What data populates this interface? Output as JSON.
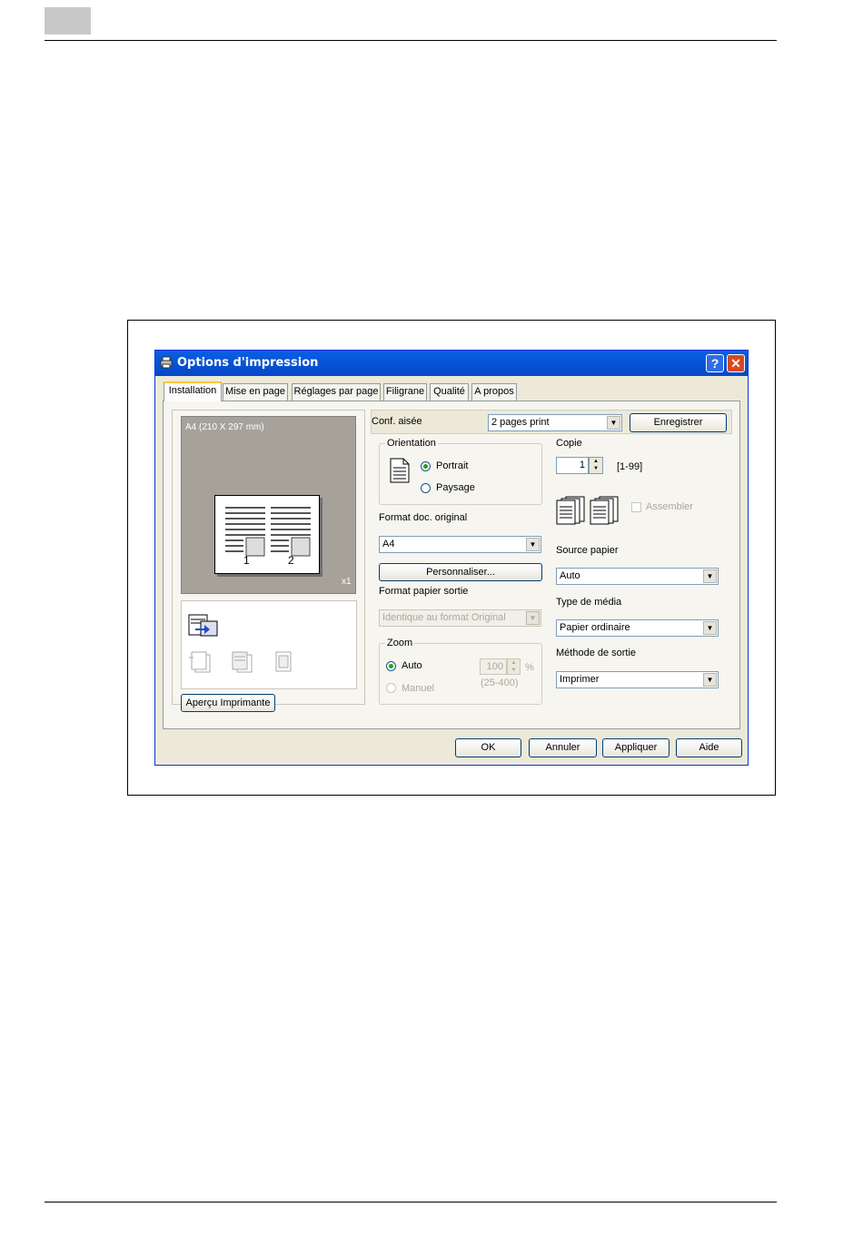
{
  "dialog": {
    "title": "Options d'impression",
    "help_label": "?",
    "close_label": "✕",
    "tabs": [
      {
        "label": "Installation"
      },
      {
        "label": "Mise en page"
      },
      {
        "label": "Réglages par page"
      },
      {
        "label": "Filigrane"
      },
      {
        "label": "Qualité"
      },
      {
        "label": "A propos"
      }
    ]
  },
  "preview": {
    "paper_label": "A4  (210 X 297 mm)",
    "copies_badge": "x1",
    "page_number_1": "1",
    "page_number_2": "2",
    "preview_button": "Aperçu Imprimante"
  },
  "easy_setup": {
    "label": "Conf. aisée",
    "value": "2 pages print",
    "save_button": "Enregistrer"
  },
  "orientation": {
    "title": "Orientation",
    "portrait": "Portrait",
    "landscape": "Paysage",
    "selected": "Portrait"
  },
  "original_size": {
    "label": "Format doc. original",
    "value": "A4",
    "custom_button": "Personnaliser..."
  },
  "output_size": {
    "label": "Format papier sortie",
    "value": "Identique au format Original"
  },
  "zoom": {
    "title": "Zoom",
    "auto": "Auto",
    "manual": "Manuel",
    "value": "100",
    "unit": "%",
    "range": "(25-400)"
  },
  "copies": {
    "label": "Copie",
    "value": "1",
    "range": "[1-99]",
    "collate": "Assembler"
  },
  "paper_source": {
    "label": "Source papier",
    "value": "Auto"
  },
  "media_type": {
    "label": "Type de média",
    "value": "Papier ordinaire"
  },
  "output_method": {
    "label": "Méthode de sortie",
    "value": "Imprimer"
  },
  "footer": {
    "ok": "OK",
    "cancel": "Annuler",
    "apply": "Appliquer",
    "help": "Aide"
  }
}
